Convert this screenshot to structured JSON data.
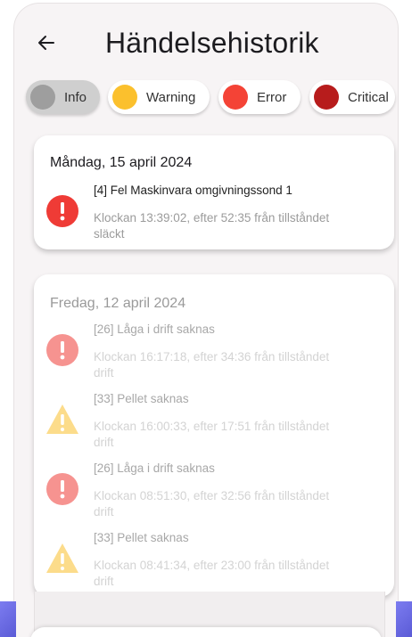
{
  "header": {
    "title": "Händelsehistorik"
  },
  "filters": [
    {
      "label": "Info",
      "color": "#9e9e9e",
      "selected": true
    },
    {
      "label": "Warning",
      "color": "#fbc02d",
      "selected": false
    },
    {
      "label": "Error",
      "color": "#f44336",
      "selected": false
    },
    {
      "label": "Critical",
      "color": "#b71c1c",
      "selected": false
    }
  ],
  "days": [
    {
      "date": "Måndag, 15 april 2024",
      "events": [
        {
          "code": "[4] Fel Maskinvara omgivningssond 1",
          "time_line1": "Klockan 13:39:02, efter 52:35 från tillståndet",
          "time_line2": "släckt",
          "type": "error"
        }
      ]
    },
    {
      "date": "Fredag, 12 april 2024",
      "events": [
        {
          "code": "[26] Låga i drift saknas",
          "time_line1": "Klockan 16:17:18, efter 34:36 från tillståndet",
          "time_line2": "drift",
          "type": "error"
        },
        {
          "code": "[33] Pellet saknas",
          "time_line1": "Klockan 16:00:33, efter 17:51 från tillståndet",
          "time_line2": "drift",
          "type": "warning"
        },
        {
          "code": "[26] Låga i drift saknas",
          "time_line1": "Klockan 08:51:30, efter 32:56 från tillståndet",
          "time_line2": "drift",
          "type": "error"
        },
        {
          "code": "[33] Pellet saknas",
          "time_line1": "Klockan 08:41:34, efter 23:00 från tillståndet",
          "time_line2": "drift",
          "type": "warning"
        }
      ]
    }
  ]
}
